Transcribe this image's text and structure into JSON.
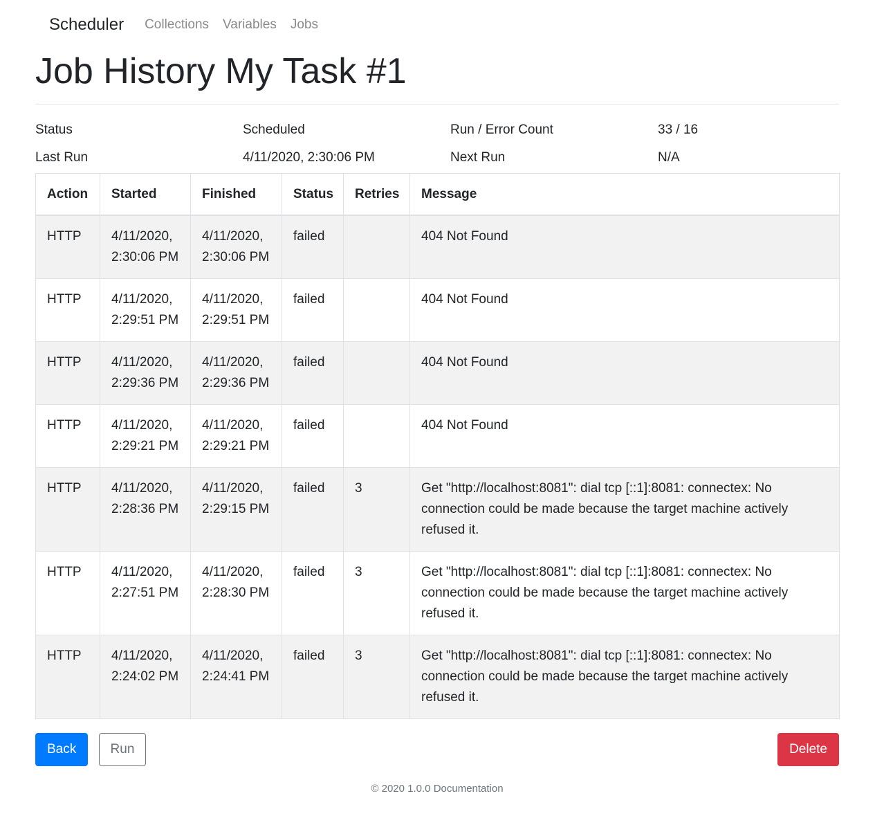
{
  "nav": {
    "brand": "Scheduler",
    "links": [
      "Collections",
      "Variables",
      "Jobs"
    ]
  },
  "page": {
    "title": "Job History My Task #1"
  },
  "summary": {
    "status_label": "Status",
    "status_value": "Scheduled",
    "count_label": "Run / Error Count",
    "count_value": "33 / 16",
    "last_run_label": "Last Run",
    "last_run_value": "4/11/2020, 2:30:06 PM",
    "next_run_label": "Next Run",
    "next_run_value": "N/A"
  },
  "table": {
    "headers": [
      "Action",
      "Started",
      "Finished",
      "Status",
      "Retries",
      "Message"
    ],
    "rows": [
      {
        "action": "HTTP",
        "started": "4/11/2020, 2:30:06 PM",
        "finished": "4/11/2020, 2:30:06 PM",
        "status": "failed",
        "retries": "",
        "message": "404 Not Found"
      },
      {
        "action": "HTTP",
        "started": "4/11/2020, 2:29:51 PM",
        "finished": "4/11/2020, 2:29:51 PM",
        "status": "failed",
        "retries": "",
        "message": "404 Not Found"
      },
      {
        "action": "HTTP",
        "started": "4/11/2020, 2:29:36 PM",
        "finished": "4/11/2020, 2:29:36 PM",
        "status": "failed",
        "retries": "",
        "message": "404 Not Found"
      },
      {
        "action": "HTTP",
        "started": "4/11/2020, 2:29:21 PM",
        "finished": "4/11/2020, 2:29:21 PM",
        "status": "failed",
        "retries": "",
        "message": "404 Not Found"
      },
      {
        "action": "HTTP",
        "started": "4/11/2020, 2:28:36 PM",
        "finished": "4/11/2020, 2:29:15 PM",
        "status": "failed",
        "retries": "3",
        "message": "Get \"http://localhost:8081\": dial tcp [::1]:8081: connectex: No connection could be made because the target machine actively refused it."
      },
      {
        "action": "HTTP",
        "started": "4/11/2020, 2:27:51 PM",
        "finished": "4/11/2020, 2:28:30 PM",
        "status": "failed",
        "retries": "3",
        "message": "Get \"http://localhost:8081\": dial tcp [::1]:8081: connectex: No connection could be made because the target machine actively refused it."
      },
      {
        "action": "HTTP",
        "started": "4/11/2020, 2:24:02 PM",
        "finished": "4/11/2020, 2:24:41 PM",
        "status": "failed",
        "retries": "3",
        "message": "Get \"http://localhost:8081\": dial tcp [::1]:8081: connectex: No connection could be made because the target machine actively refused it."
      }
    ]
  },
  "buttons": {
    "back": "Back",
    "run": "Run",
    "delete": "Delete"
  },
  "footer": {
    "copyright": "© 2020 1.0.0",
    "docs_link": "Documentation"
  },
  "colors": {
    "primary": "#007bff",
    "danger": "#dc3545",
    "stripe": "#f2f2f2"
  }
}
